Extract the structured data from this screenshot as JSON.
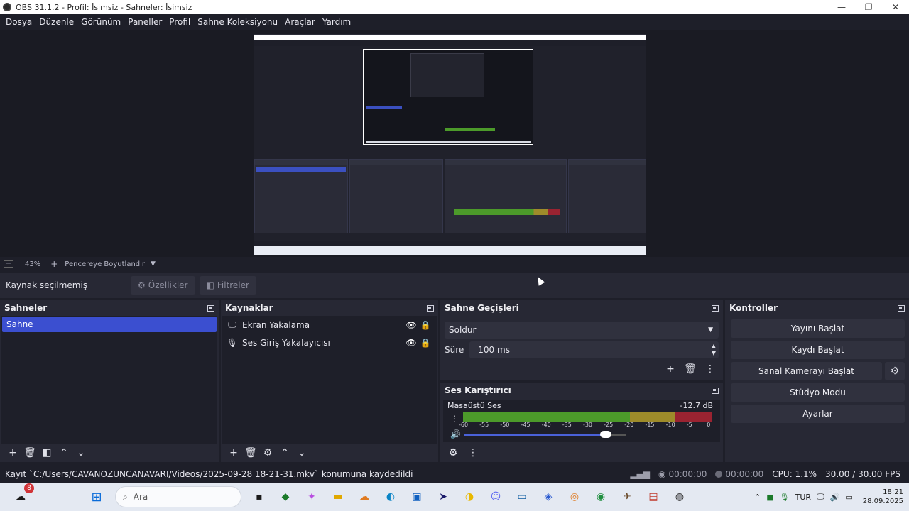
{
  "window": {
    "title": "OBS 31.1.2 - Profil: İsimsiz - Sahneler: İsimsiz",
    "minimize": "—",
    "maximize": "❐",
    "close": "✕"
  },
  "menu": [
    "Dosya",
    "Düzenle",
    "Görünüm",
    "Paneller",
    "Profil",
    "Sahne Koleksiyonu",
    "Araçlar",
    "Yardım"
  ],
  "zoom": {
    "value": "43%",
    "fit_label": "Pencereye Boyutlandır"
  },
  "source_toolbar": {
    "status": "Kaynak seçilmemiş",
    "properties": "Özellikler",
    "filters": "Filtreler"
  },
  "scenes": {
    "title": "Sahneler",
    "items": [
      "Sahne"
    ]
  },
  "sources": {
    "title": "Kaynaklar",
    "items": [
      {
        "icon": "monitor-icon",
        "label": "Ekran Yakalama"
      },
      {
        "icon": "microphone-icon",
        "label": "Ses Giriş Yakalayıcısı"
      }
    ]
  },
  "transitions": {
    "title": "Sahne Geçişleri",
    "selected": "Soldur",
    "duration_label": "Süre",
    "duration_value": "100 ms"
  },
  "mixer": {
    "title": "Ses Karıştırıcı",
    "track_name": "Masaüstü Ses",
    "level": "-12.7 dB",
    "volume_fraction": 0.91,
    "scale": [
      "-60",
      "-55",
      "-50",
      "-45",
      "-40",
      "-35",
      "-30",
      "-25",
      "-20",
      "-15",
      "-10",
      "-5",
      "0"
    ]
  },
  "controls": {
    "title": "Kontroller",
    "start_stream": "Yayını Başlat",
    "start_record": "Kaydı Başlat",
    "start_virtualcam": "Sanal Kamerayı Başlat",
    "studio_mode": "Stüdyo Modu",
    "settings": "Ayarlar"
  },
  "status": {
    "message": "Kayıt `C:/Users/CAVANOZUNCANAVARI/Videos/2025-09-28 18-21-31.mkv` konumuna kaydedildi",
    "stream_time": "00:00:00",
    "record_time": "00:00:00",
    "cpu": "CPU: 1.1%",
    "fps": "30.00 / 30.00 FPS"
  },
  "taskbar": {
    "search_placeholder": "Ara",
    "weather_badge": "8",
    "language": "TUR",
    "time": "18:21",
    "date": "28.09.2025"
  },
  "colors": {
    "accent": "#3b4fd0",
    "background": "#1e1f29",
    "panel": "#272834",
    "meter_green": "#4c9a2a",
    "meter_yellow": "#9e8b2a",
    "meter_red": "#9a2331"
  }
}
